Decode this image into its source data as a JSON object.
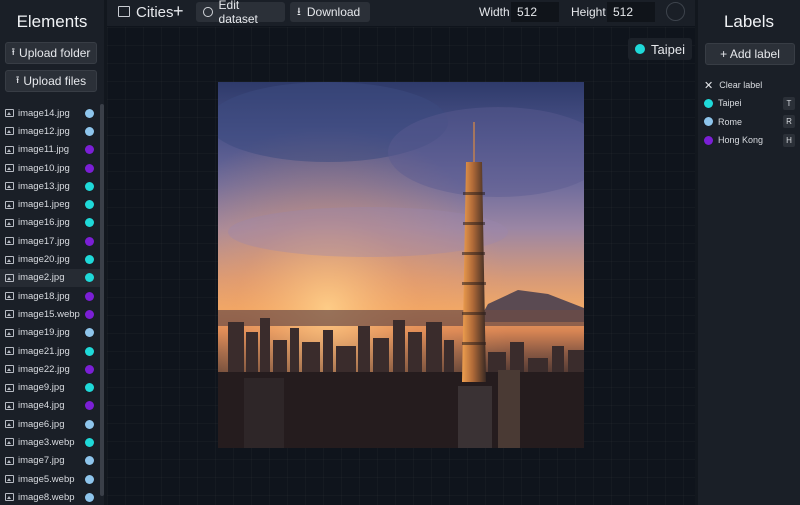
{
  "left_panel": {
    "title": "Elements",
    "upload_folder": "Upload folder",
    "upload_files": "Upload files",
    "files": [
      {
        "name": "image14.jpg",
        "color": "#8ec5ec"
      },
      {
        "name": "image12.jpg",
        "color": "#8ec5ec"
      },
      {
        "name": "image11.jpg",
        "color": "#7b1fd6"
      },
      {
        "name": "image10.jpg",
        "color": "#7b1fd6"
      },
      {
        "name": "image13.jpg",
        "color": "#1fd9d9"
      },
      {
        "name": "image1.jpeg",
        "color": "#1fd9d9"
      },
      {
        "name": "image16.jpg",
        "color": "#1fd9d9"
      },
      {
        "name": "image17.jpg",
        "color": "#7b1fd6"
      },
      {
        "name": "image20.jpg",
        "color": "#1fd9d9"
      },
      {
        "name": "image2.jpg",
        "color": "#1fd9d9",
        "selected": true
      },
      {
        "name": "image18.jpg",
        "color": "#7b1fd6"
      },
      {
        "name": "image15.webp",
        "color": "#7b1fd6"
      },
      {
        "name": "image19.jpg",
        "color": "#8ec5ec"
      },
      {
        "name": "image21.jpg",
        "color": "#1fd9d9"
      },
      {
        "name": "image22.jpg",
        "color": "#7b1fd6"
      },
      {
        "name": "image9.jpg",
        "color": "#1fd9d9"
      },
      {
        "name": "image4.jpg",
        "color": "#7b1fd6"
      },
      {
        "name": "image6.jpg",
        "color": "#8ec5ec"
      },
      {
        "name": "image3.webp",
        "color": "#1fd9d9"
      },
      {
        "name": "image7.jpg",
        "color": "#8ec5ec"
      },
      {
        "name": "image5.webp",
        "color": "#8ec5ec"
      },
      {
        "name": "image8.webp",
        "color": "#8ec5ec"
      }
    ]
  },
  "topbar": {
    "dataset_name": "Cities",
    "add_icon": "+",
    "edit_dataset": "Edit dataset",
    "download": "Download",
    "width_label": "Width",
    "width_value": "512",
    "height_label": "Height",
    "height_value": "512"
  },
  "canvas": {
    "current_label": "Taipei",
    "current_label_color": "#1fd9d9",
    "image_description": "photo"
  },
  "right_panel": {
    "title": "Labels",
    "add_label": "+ Add label",
    "clear_label": "Clear label",
    "labels": [
      {
        "name": "Taipei",
        "color": "#1fd9d9",
        "key": "T"
      },
      {
        "name": "Rome",
        "color": "#8ec5ec",
        "key": "R"
      },
      {
        "name": "Hong Kong",
        "color": "#7b1fd6",
        "key": "H"
      }
    ]
  },
  "icons": {
    "upload": "upload-icon",
    "image_file": "image-file-icon",
    "dataset": "dataset-icon",
    "edit": "edit-icon",
    "download": "download-icon",
    "close": "close-icon"
  }
}
